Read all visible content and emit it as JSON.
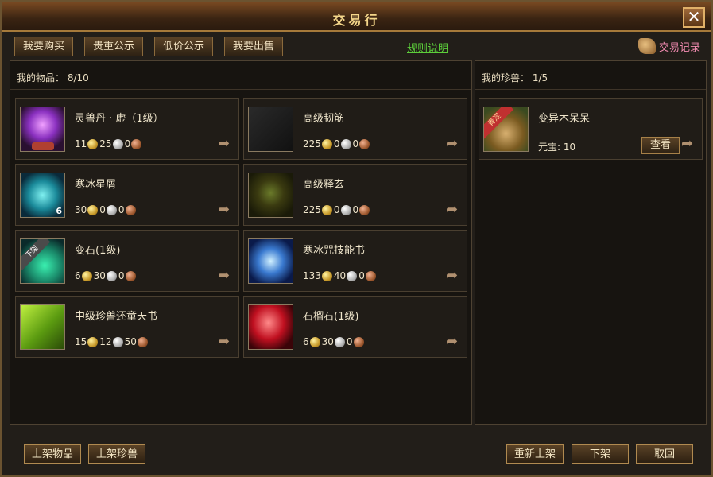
{
  "window": {
    "title": "交易行",
    "close_icon": "close-icon"
  },
  "tabs": [
    "我要购买",
    "贵重公示",
    "低价公示",
    "我要出售"
  ],
  "rules_link": "规则说明",
  "trade_record": {
    "label": "交易记录",
    "icon": "scroll-icon"
  },
  "my_items": {
    "header_label": "我的物品：",
    "count": "8/10",
    "items": [
      {
        "name": "灵兽丹 · 虚（1级）",
        "icon": "crystal-ball-icon",
        "price": [
          "11",
          "25",
          "0"
        ],
        "qty": ""
      },
      {
        "name": "高级韧筋",
        "icon": "dark-tile-icon",
        "price": [
          "225",
          "0",
          "0"
        ],
        "qty": ""
      },
      {
        "name": "寒冰星屑",
        "icon": "ice-shards-icon",
        "price": [
          "30",
          "0",
          "0"
        ],
        "qty": "6"
      },
      {
        "name": "高级释玄",
        "icon": "golden-warrior-icon",
        "price": [
          "225",
          "0",
          "0"
        ],
        "qty": ""
      },
      {
        "name": "变石(1级)",
        "icon": "green-gem-icon",
        "price": [
          "6",
          "30",
          "0"
        ],
        "qty": "",
        "ribbon": "下架"
      },
      {
        "name": "寒冰咒技能书",
        "icon": "ice-claw-book-icon",
        "price": [
          "133",
          "40",
          "0"
        ],
        "qty": ""
      },
      {
        "name": "中级珍兽还童天书",
        "icon": "green-scroll-icon",
        "price": [
          "15",
          "12",
          "50"
        ],
        "qty": ""
      },
      {
        "name": "石榴石(1级)",
        "icon": "red-stone-icon",
        "price": [
          "6",
          "30",
          "0"
        ],
        "qty": ""
      }
    ]
  },
  "my_pets": {
    "header_label": "我的珍兽：",
    "count": "1/5",
    "pets": [
      {
        "name": "变异木呆呆",
        "icon": "tree-pet-icon",
        "ribbon": "青涩",
        "yuanbao_label": "元宝:",
        "yuanbao": "10",
        "view_label": "查看"
      }
    ]
  },
  "bottom_buttons": {
    "list_item": "上架物品",
    "list_pet": "上架珍兽",
    "relist": "重新上架",
    "delist": "下架",
    "cancel": "取回"
  },
  "colors": {
    "accent_gold": "#f4d68a",
    "link_green": "#5ccf3a",
    "record_pink": "#f08ab0",
    "frame_brown": "#6b5330"
  }
}
